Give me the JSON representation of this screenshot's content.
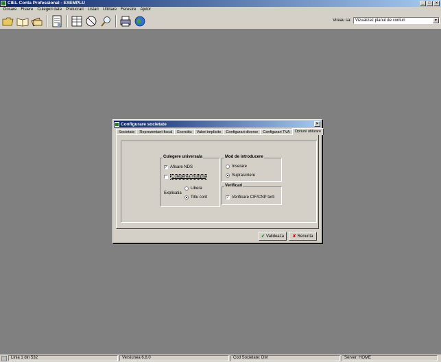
{
  "app": {
    "title": "CIEL Conta Professional - EXEMPLU"
  },
  "window_controls": {
    "minimize": "_",
    "maximize": "□",
    "close": "×"
  },
  "menu": [
    "Dosare",
    "Fisiere",
    "Culegeri date",
    "Prelucrari",
    "Listari",
    "Utilitare",
    "Ferestre",
    "Ajutor"
  ],
  "toolbar": {
    "icons": [
      "open-folder-icon",
      "book-icon",
      "books-icon",
      "calculator-icon",
      "ledger-icon",
      "stamp-icon",
      "search-icon",
      "printer-icon",
      "globe-icon"
    ],
    "view_label": "Vireau sa:",
    "view_value": "Vizualizez planul de conturi"
  },
  "dialog": {
    "title": "Configurare societate",
    "close": "×",
    "tabs": [
      "Societate",
      "Reprezentant fiscal",
      "Exercitiu",
      "Valori implicite",
      "Configurari diverse",
      "Configurari TVA",
      "Optiuni utilizare"
    ],
    "active_tab": "Optiuni utilizare",
    "culegere": {
      "title": "Culegere universala",
      "afisare_nds": "Afisare NDS",
      "afisare_nds_checked": true,
      "culegerea_multipla": "Culegerea multipla",
      "culegerea_multipla_checked": false,
      "explicatia_label": "Explicatia",
      "libera": "Libera",
      "titlu_cont": "Titlu cont",
      "explicatia_selected": "Titlu cont"
    },
    "mod": {
      "title": "Mod de introducere",
      "inserare": "Inserare",
      "suprascriere": "Suprascriere",
      "selected": "Suprascriere"
    },
    "verificari": {
      "title": "Verificari",
      "cif_cnp": "Verificare CIF/CNP terti",
      "cif_cnp_checked": true
    },
    "buttons": {
      "validate": "Valideaza",
      "cancel": "Renunta"
    }
  },
  "status": {
    "line": "Linia 1 din 532",
    "version": "Versiunea  6.8.0",
    "company": "Cod Societate: DM",
    "server": "Server: HOME"
  }
}
